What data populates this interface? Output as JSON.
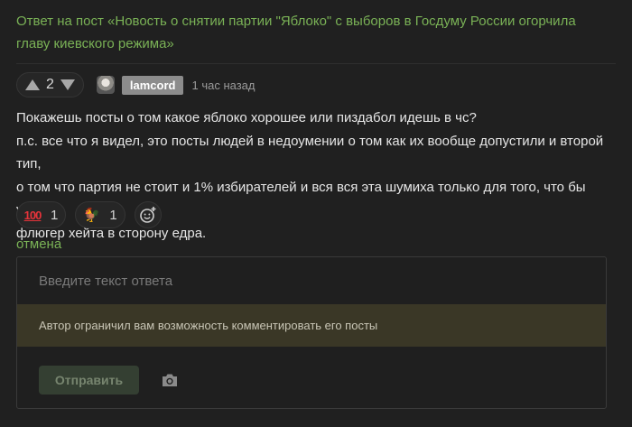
{
  "post": {
    "title": "Ответ на пост «Новость о снятии партии \"Яблоко\" с выборов в Госдуму России огорчила главу киевского режима»"
  },
  "comment": {
    "votes": "2",
    "author": "lamcord",
    "timestamp": "1 час назад",
    "lines": [
      "Покажешь посты о том какое яблоко хорошее или пиздабол идешь в чс?",
      "п.с. все что я видел, это посты людей в недоумении о том как их вообще допустили и второй тип,",
      "о том что партия не стоит и 1% избирателей и вся вся эта шумиха только для того, что бы убрать",
      "флюгер хейта в сторону едра."
    ]
  },
  "reactions": [
    {
      "icon": "hundred-points-icon",
      "glyph": "100",
      "count": "1"
    },
    {
      "icon": "rooster-icon",
      "glyph": "🐓",
      "count": "1"
    }
  ],
  "reply": {
    "cancel_label": "отмена",
    "placeholder": "Введите текст ответа",
    "restriction_notice": "Автор ограничил вам возможность комментировать его посты",
    "send_label": "Отправить"
  },
  "colors": {
    "background": "#202020",
    "link_green": "#7ab256",
    "notice_bg": "#3a3726",
    "send_bg_disabled": "#343f32"
  }
}
